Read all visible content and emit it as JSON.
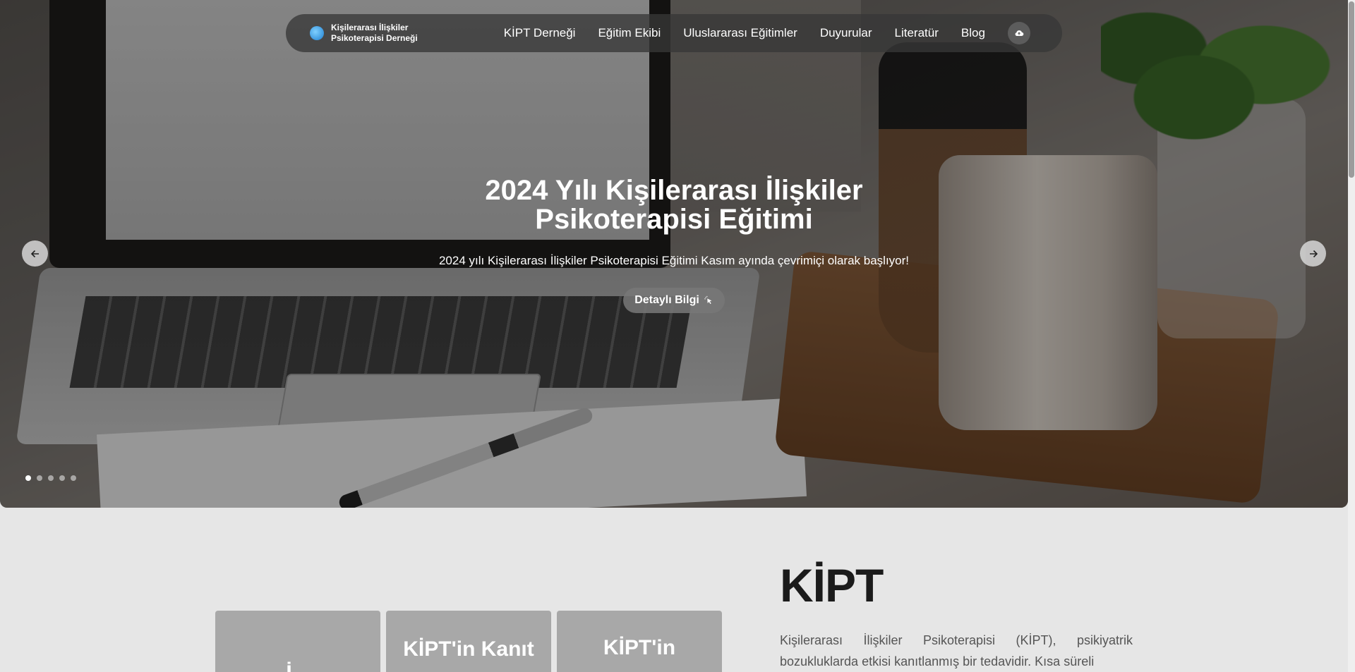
{
  "brand": {
    "name_line1": "Kişilerarası İlişkiler",
    "name_line2": "Psikoterapisi Derneği"
  },
  "nav": {
    "links": [
      "KİPT Derneği",
      "Eğitim Ekibi",
      "Uluslararası Eğitimler",
      "Duyurular",
      "Literatür",
      "Blog"
    ],
    "action_icon": "cloud-upload-icon"
  },
  "hero": {
    "title_line1": "2024 Yılı Kişilerarası İlişkiler",
    "title_line2": "Psikoterapisi Eğitimi",
    "subtitle": "2024 yılı Kişilerarası İlişkiler Psikoterapisi Eğitimi Kasım ayında çevrimiçi olarak başlıyor!",
    "button_label": "Detaylı Bilgi",
    "button_icon": "pointer-click-icon",
    "slide_count": 5,
    "active_slide": 1
  },
  "cards": [
    "İ...",
    "KİPT'in Kanıt",
    "KİPT'in"
  ],
  "about": {
    "title": "KİPT",
    "text": "Kişilerarası İlişkiler Psikoterapisi (KİPT), psikiyatrik bozukluklarda etkisi kanıtlanmış bir tedavidir. Kısa süreli"
  }
}
